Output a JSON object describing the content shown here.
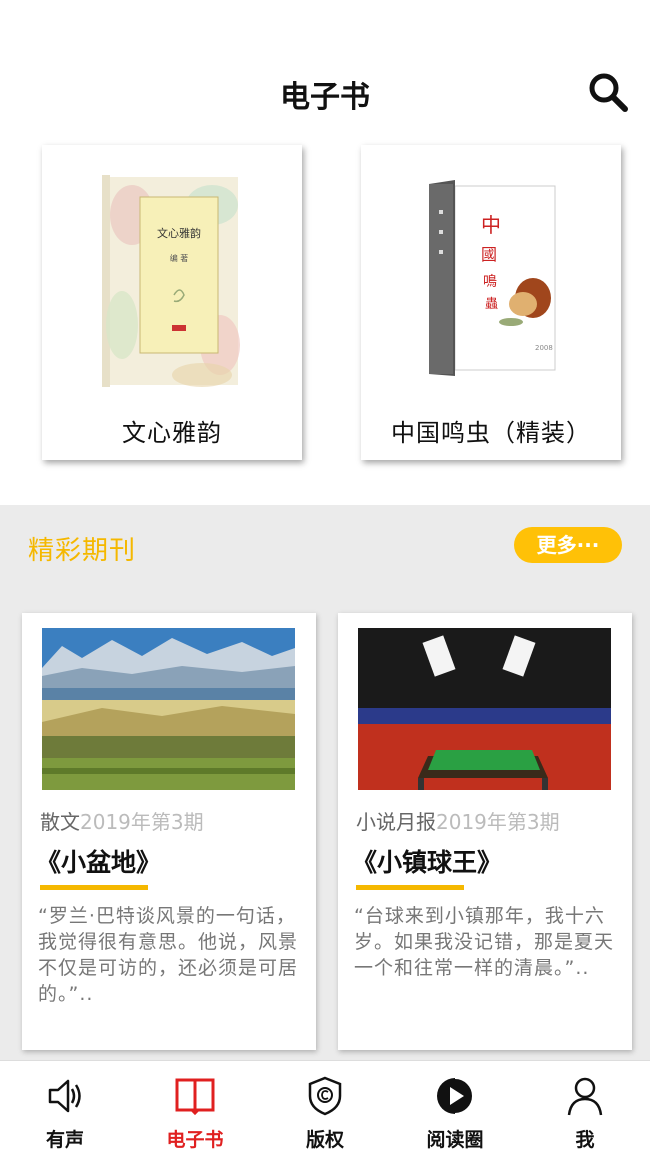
{
  "header": {
    "title": "电子书"
  },
  "books": [
    {
      "title": "文心雅韵",
      "cover_text": "文心雅韵"
    },
    {
      "title": "中国鸣虫（精装）",
      "cover_text": "中国鸣虫"
    }
  ],
  "section": {
    "title": "精彩期刊",
    "more_label": "更多···"
  },
  "magazines": [
    {
      "category": "散文",
      "issue": "2019年第3期",
      "title": "《小盆地》",
      "excerpt": "“罗兰·巴特谈风景的一句话，我觉得很有意思。他说，风景不仅是可访的，还必须是可居的。”.."
    },
    {
      "category": "小说月报",
      "issue": "2019年第3期",
      "title": "《小镇球王》",
      "excerpt": "“台球来到小镇那年，我十六岁。如果我没记错，那是夏天一个和往常一样的清晨。”.."
    }
  ],
  "tabs": [
    {
      "label": "有声",
      "icon": "speaker-icon"
    },
    {
      "label": "电子书",
      "icon": "book-icon",
      "active": true
    },
    {
      "label": "版权",
      "icon": "copyright-shield-icon"
    },
    {
      "label": "阅读圈",
      "icon": "play-circle-icon"
    },
    {
      "label": "我",
      "icon": "person-icon"
    }
  ],
  "colors": {
    "accent": "#f5b800",
    "active_tab": "#e02020",
    "more_button": "#ffc107"
  }
}
